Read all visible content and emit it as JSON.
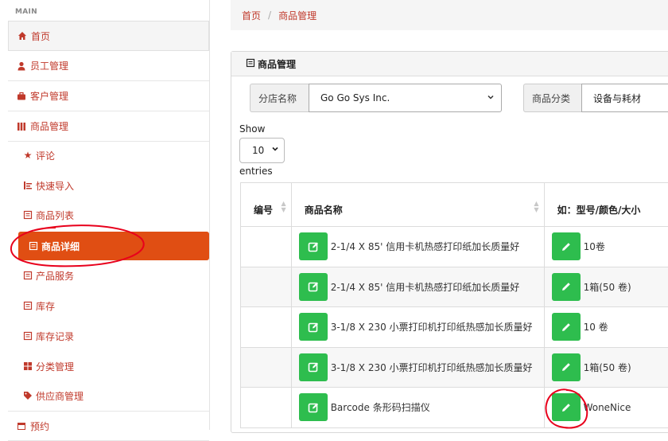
{
  "sidebar": {
    "section": "MAIN",
    "items": [
      {
        "label": "首页",
        "icon": "home-icon"
      },
      {
        "label": "员工管理",
        "icon": "user-icon"
      },
      {
        "label": "客户管理",
        "icon": "briefcase-icon"
      },
      {
        "label": "商品管理",
        "icon": "columns-icon"
      }
    ],
    "sub_items": [
      {
        "label": "评论",
        "icon": "star-icon"
      },
      {
        "label": "快速导入",
        "icon": "import-icon"
      },
      {
        "label": "商品列表",
        "icon": "list-icon"
      },
      {
        "label": "商品详细",
        "icon": "detail-icon"
      },
      {
        "label": "产品服务",
        "icon": "list-icon"
      },
      {
        "label": "库存",
        "icon": "list-icon"
      },
      {
        "label": "库存记录",
        "icon": "list-icon"
      },
      {
        "label": "分类管理",
        "icon": "grid-icon"
      },
      {
        "label": "供应商管理",
        "icon": "tag-icon"
      }
    ],
    "bottom_item": {
      "label": "预约",
      "icon": "calendar-icon"
    }
  },
  "breadcrumb": {
    "home": "首页",
    "current": "商品管理"
  },
  "panel": {
    "title": "商品管理",
    "filters": {
      "store_label": "分店名称",
      "store_value": "Go Go Sys Inc.",
      "category_label": "商品分类",
      "category_value": "设备与耗材"
    },
    "show_label": "Show",
    "entries_value": "10",
    "entries_label": "entries"
  },
  "table": {
    "headers": {
      "id": "编号",
      "name": "商品名称",
      "spec": "如：型号/颜色/大小"
    },
    "rows": [
      {
        "id": "",
        "name": "2-1/4 X 85' 信用卡机热感打印纸加长质量好",
        "spec": "10卷"
      },
      {
        "id": "",
        "name": "2-1/4 X 85' 信用卡机热感打印纸加长质量好",
        "spec": "1箱(50 卷)"
      },
      {
        "id": "",
        "name": "3-1/8 X 230 小票打印机打印纸热感加长质量好",
        "spec": "10 卷"
      },
      {
        "id": "",
        "name": "3-1/8 X 230 小票打印机打印纸热感加长质量好",
        "spec": "1箱(50 卷)"
      },
      {
        "id": "",
        "name": "Barcode 条形码扫描仪",
        "spec": "WoneNice"
      }
    ]
  },
  "colors": {
    "accent": "#e04e13",
    "link": "#c0392b",
    "edit_button": "#2ebd4e",
    "annotation": "#e8001c"
  }
}
